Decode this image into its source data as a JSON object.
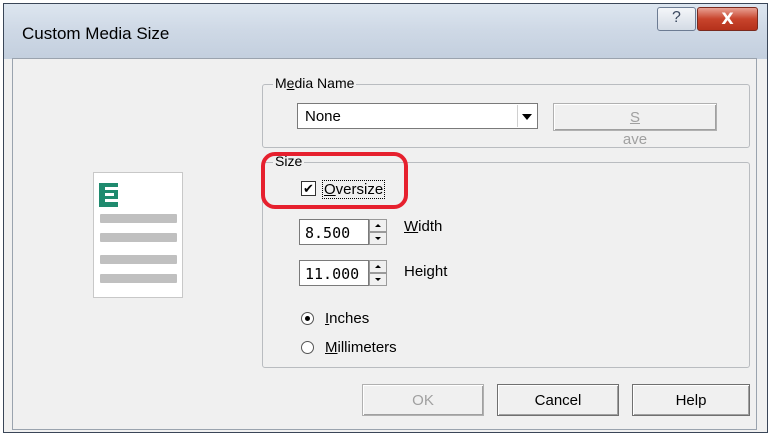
{
  "window": {
    "title": "Custom Media Size",
    "help_button": "?",
    "close_button": "X"
  },
  "media_name": {
    "legend_pre": "M",
    "legend_ul": "e",
    "legend_post": "dia Name",
    "selected": "None",
    "save_pre": "",
    "save_ul": "S",
    "save_post": "ave"
  },
  "size": {
    "legend": "Size",
    "oversize_pre": "",
    "oversize_ul": "O",
    "oversize_post": "versize",
    "oversize_checked": true,
    "width_value": "8.500",
    "width_pre": "",
    "width_ul": "W",
    "width_post": "idth",
    "height_value": "11.000",
    "height_pre": "Hei",
    "height_ul": "g",
    "height_post": "ht",
    "inches_pre": "",
    "inches_ul": "I",
    "inches_post": "nches",
    "millimeters_pre": "",
    "millimeters_ul": "M",
    "millimeters_post": "illimeters",
    "unit_selected": "Inches"
  },
  "buttons": {
    "ok": "OK",
    "cancel": "Cancel",
    "help": "Help"
  },
  "colors": {
    "highlight": "#e6202e",
    "logo": "#1f8a6e"
  }
}
